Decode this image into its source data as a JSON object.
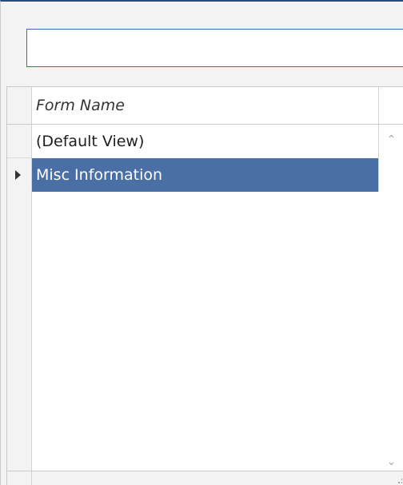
{
  "search": {
    "value": "",
    "placeholder": ""
  },
  "grid": {
    "columns": [
      "Form Name"
    ],
    "rows": [
      {
        "name": "(Default View)",
        "selected": false
      },
      {
        "name": "Misc Information",
        "selected": true
      }
    ]
  },
  "scrollbar": {
    "up_icon": "chevron-up-icon",
    "down_icon": "chevron-down-icon"
  },
  "colors": {
    "selection": "#4a6fa5",
    "border_accent": "#3c6bb0",
    "panel_bg": "#f3f3f3"
  }
}
